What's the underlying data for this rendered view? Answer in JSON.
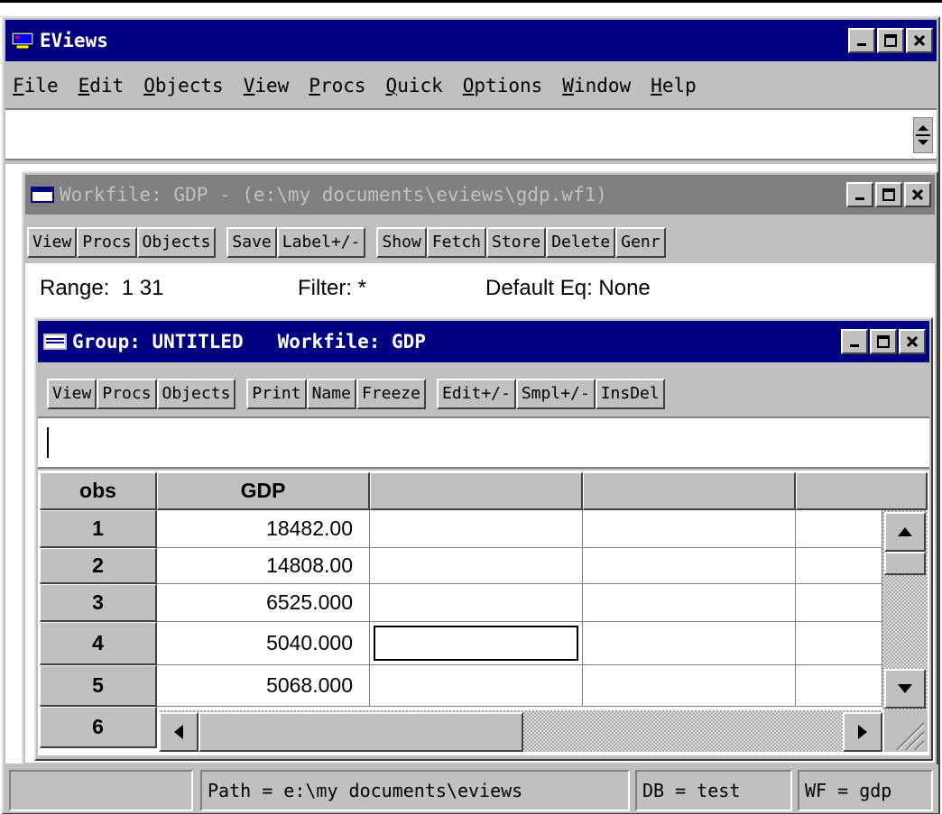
{
  "app": {
    "title": "EViews",
    "menu": [
      "File",
      "Edit",
      "Objects",
      "View",
      "Procs",
      "Quick",
      "Options",
      "Window",
      "Help"
    ]
  },
  "workfile_window": {
    "title": "Workfile: GDP - (e:\\my documents\\eviews\\gdp.wf1)",
    "buttons": [
      "View",
      "Procs",
      "Objects",
      "Save",
      "Label+/-",
      "Show",
      "Fetch",
      "Store",
      "Delete",
      "Genr"
    ],
    "range_label": "Range:",
    "range_value": "1 31",
    "filter_label": "Filter: *",
    "default_eq_label": "Default Eq: None"
  },
  "group_window": {
    "title": "Group: UNTITLED   Workfile: GDP",
    "buttons": [
      "View",
      "Procs",
      "Objects",
      "Print",
      "Name",
      "Freeze",
      "Edit+/-",
      "Smpl+/-",
      "InsDel"
    ],
    "edit_value": "",
    "columns": [
      "obs",
      "GDP",
      "",
      "",
      ""
    ],
    "rows": [
      {
        "obs": "1",
        "gdp": "18482.00"
      },
      {
        "obs": "2",
        "gdp": "14808.00"
      },
      {
        "obs": "3",
        "gdp": "6525.000"
      },
      {
        "obs": "4",
        "gdp": "5040.000"
      },
      {
        "obs": "5",
        "gdp": "5068.000"
      },
      {
        "obs": "6",
        "gdp": ""
      }
    ]
  },
  "statusbar": {
    "path": "Path = e:\\my documents\\eviews",
    "db": "DB = test",
    "wf": "WF = gdp"
  },
  "colors": {
    "active_title": "#000080",
    "inactive_title": "#808080",
    "face": "#c0c0c0"
  }
}
